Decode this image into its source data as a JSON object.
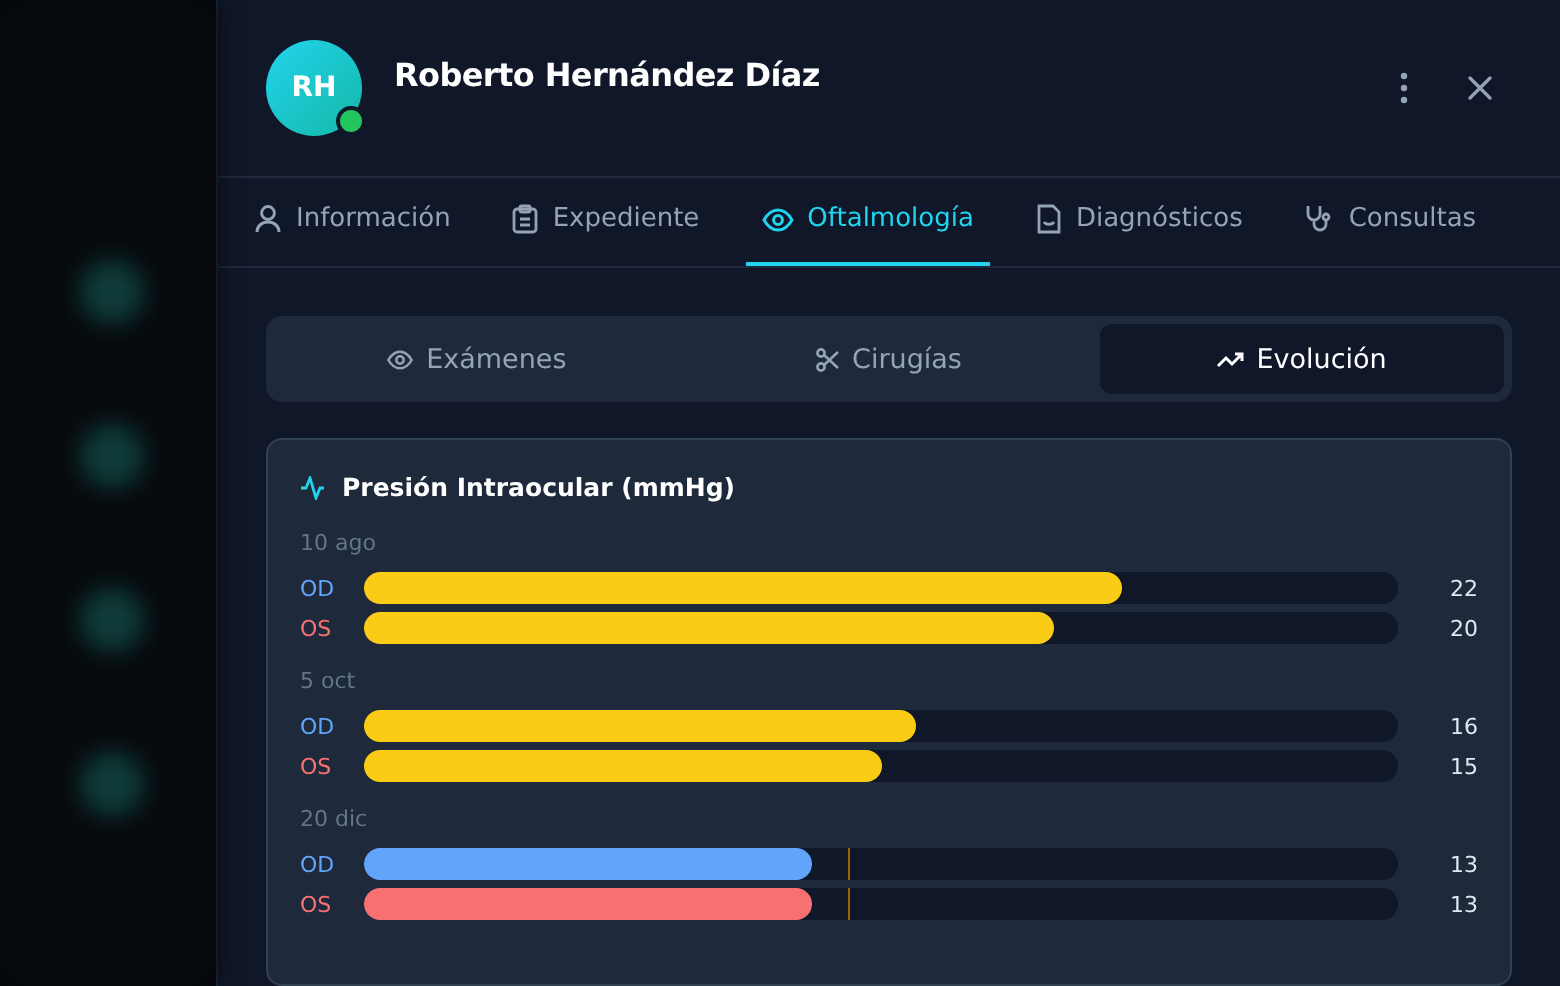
{
  "patient": {
    "initials": "RH",
    "name": "Roberto Hernández Díaz",
    "online": true
  },
  "tabs": [
    {
      "label": "Información",
      "kind": "person",
      "selected": false
    },
    {
      "label": "Expediente",
      "kind": "clipboard",
      "selected": false
    },
    {
      "label": "Oftalmología",
      "kind": "eye",
      "selected": true
    },
    {
      "label": "Diagnósticos",
      "kind": "file",
      "selected": false
    },
    {
      "label": "Consultas",
      "kind": "stethoscope",
      "selected": false
    }
  ],
  "subtabs": [
    {
      "label": "Exámenes",
      "kind": "eye",
      "selected": false
    },
    {
      "label": "Cirugías",
      "kind": "scissors",
      "selected": false
    },
    {
      "label": "Evolución",
      "kind": "trend",
      "selected": true
    }
  ],
  "card": {
    "title": "Presión Intraocular (mmHg)",
    "groups": [
      {
        "date": "10 ago",
        "bars": [
          {
            "eye": "OD",
            "level": 0.733,
            "value": "22",
            "color": "#facc15"
          },
          {
            "eye": "OS",
            "level": 0.667,
            "value": "20",
            "color": "#facc15"
          }
        ]
      },
      {
        "date": "5 oct",
        "bars": [
          {
            "eye": "OD",
            "level": 0.534,
            "value": "16",
            "color": "#facc15"
          },
          {
            "eye": "OS",
            "level": 0.5,
            "value": "15",
            "color": "#facc15"
          }
        ]
      },
      {
        "date": "20 dic",
        "bars": [
          {
            "eye": "OD",
            "level": 0.433,
            "value": "13",
            "color": "#60a5fa",
            "marker": {
              "level": 0.468
            }
          },
          {
            "eye": "OS",
            "level": 0.433,
            "value": "13",
            "color": "#f87171",
            "marker": {
              "level": 0.468
            }
          }
        ]
      }
    ]
  }
}
